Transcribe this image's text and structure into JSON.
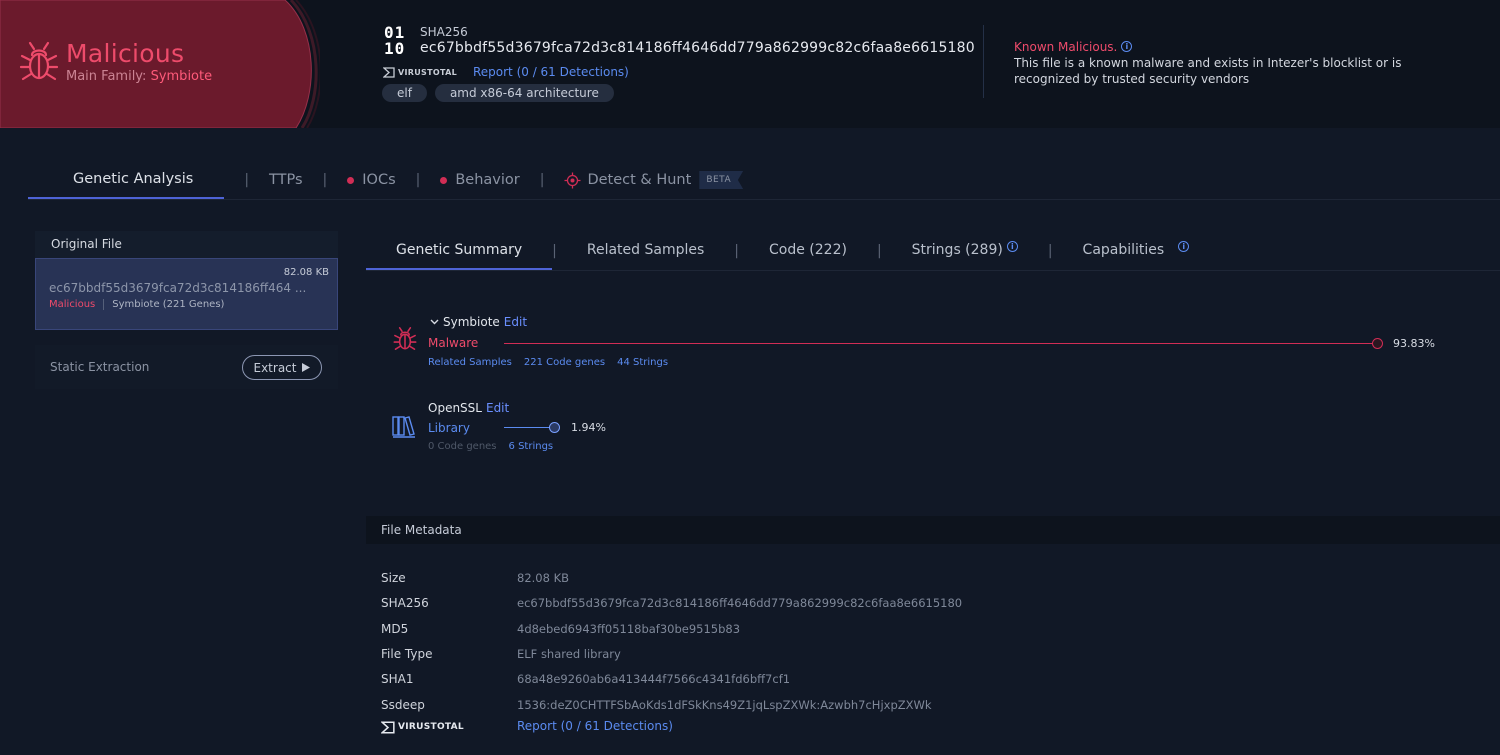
{
  "header": {
    "verdict": "Malicious",
    "family_prefix": "Main Family:",
    "family_name": "Symbiote",
    "binary_icon_top": "01",
    "binary_icon_bottom": "10",
    "sha_label": "SHA256",
    "sha_value": "ec67bbdf55d3679fca72d3c814186ff4646dd779a862999c82c6faa8e6615180",
    "virustotal_label": "VIRUSTOTAL",
    "report_link": "Report (0 / 61 Detections)",
    "tags": [
      "elf",
      "amd x86-64 architecture"
    ],
    "known_title": "Known Malicious.",
    "known_desc": "This file is a known malware and exists in Intezer's blocklist or is recognized by trusted security vendors"
  },
  "main_tabs": {
    "genetic": "Genetic Analysis",
    "ttps": "TTPs",
    "iocs": "IOCs",
    "behavior": "Behavior",
    "detect": "Detect & Hunt",
    "beta": "BETA",
    "separator": "|"
  },
  "sidebar": {
    "original_file_label": "Original File",
    "file_size": "82.08 KB",
    "file_hash": "ec67bbdf55d3679fca72d3c814186ff464 ...",
    "file_verdict": "Malicious",
    "file_family": "Symbiote (221 Genes)",
    "static_label": "Static Extraction",
    "extract_label": "Extract"
  },
  "sub_tabs": {
    "summary": "Genetic Summary",
    "related": "Related Samples",
    "code": "Code (222)",
    "strings": "Strings (289)",
    "capabilities": "Capabilities"
  },
  "genes": [
    {
      "name": "Symbiote",
      "edit": "Edit",
      "type": "Malware",
      "percent": "93.83%",
      "share": 0.9383,
      "links": [
        "Related Samples",
        "221 Code genes",
        "44 Strings"
      ],
      "color": "#d12d55"
    },
    {
      "name": "OpenSSL",
      "edit": "Edit",
      "type": "Library",
      "percent": "1.94%",
      "share": 0.0194,
      "links": [
        "0 Code genes",
        "6 Strings"
      ],
      "color": "#5b8bf0"
    }
  ],
  "metadata": {
    "title": "File Metadata",
    "rows": [
      {
        "key": "Size",
        "value": "82.08 KB"
      },
      {
        "key": "SHA256",
        "value": "ec67bbdf55d3679fca72d3c814186ff4646dd779a862999c82c6faa8e6615180"
      },
      {
        "key": "MD5",
        "value": "4d8ebed6943ff05118baf30be9515b83"
      },
      {
        "key": "File Type",
        "value": "ELF shared library"
      },
      {
        "key": "SHA1",
        "value": "68a48e9260ab6a413444f7566c4341fd6bff7cf1"
      },
      {
        "key": "Ssdeep",
        "value": "1536:deZ0CHTTFSbAoKds1dFSkKns49Z1jqLspZXWk:Azwbh7cHjxpZXWk"
      }
    ],
    "virustotal_label": "VIRUSTOTAL",
    "report": "Report (0 / 61 Detections)"
  },
  "icons": {
    "verdict": "bug-icon",
    "binary": "binary-file-icon",
    "virustotal": "virustotal-icon",
    "info": "info-icon",
    "detect": "crosshair-icon",
    "extract": "play-icon",
    "chevron": "chevron-down-icon",
    "library": "books-icon"
  },
  "colors": {
    "malicious": "#ee4b6b",
    "accent": "#4e63d6",
    "link": "#5b8bf0",
    "background": "#111826"
  }
}
